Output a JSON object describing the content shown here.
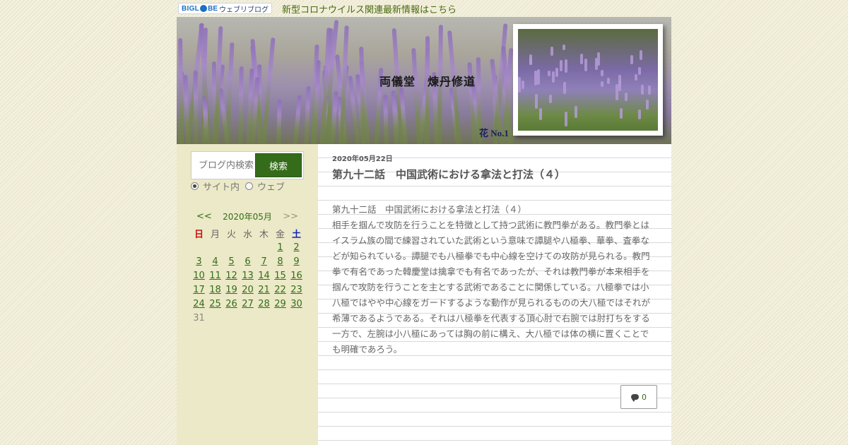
{
  "topbar": {
    "logo": {
      "part1": "BIGL",
      "part2": "BE",
      "part3": "ウェブリブログ"
    },
    "notice_link": "新型コロナウイルス関連最新情報はこちら"
  },
  "header": {
    "blog_title": "両儀堂　煉丹修道",
    "photo_caption": "花 No.1"
  },
  "sidebar": {
    "search": {
      "placeholder": "ブログ内検索",
      "button": "検索"
    },
    "scope": {
      "site": "サイト内",
      "web": "ウェブ",
      "selected": "サイト内"
    },
    "calendar": {
      "prev": "<<",
      "month": "2020年05月",
      "next": ">>",
      "weekdays": [
        "日",
        "月",
        "火",
        "水",
        "木",
        "金",
        "土"
      ],
      "weeks": [
        [
          "",
          "",
          "",
          "",
          "",
          "1",
          "2"
        ],
        [
          "3",
          "4",
          "5",
          "6",
          "7",
          "8",
          "9"
        ],
        [
          "10",
          "11",
          "12",
          "13",
          "14",
          "15",
          "16"
        ],
        [
          "17",
          "18",
          "19",
          "20",
          "21",
          "22",
          "23"
        ],
        [
          "24",
          "25",
          "26",
          "27",
          "28",
          "29",
          "30"
        ],
        [
          "31",
          "",
          "",
          "",
          "",
          "",
          ""
        ]
      ],
      "unlinked_days": [
        "31"
      ]
    }
  },
  "post": {
    "date": "2020年05月22日",
    "title": "第九十二話　中国武術における拿法と打法（４）",
    "body": [
      "第九十二話　中国武術における拿法と打法（４）",
      "相手を掴んで攻防を行うことを特徴として持つ武術に教門拳がある。教門拳とはイスラム族の間で練習されていた武術という意味で譚腿や八極拳、華拳、査拳などが知られている。譚腿でも八極拳でも中心線を空けての攻防が見られる。教門拳で有名であった韓慶堂は擒拿でも有名であったが、それは教門拳が本来相手を掴んで攻防を行うことを主とする武術であることに関係している。八極拳では小八極ではやや中心線をガードするような動作が見られるものの大八極ではそれが希薄であるようである。それは八極拳を代表する頂心肘で右腕では肘打ちをする一方で、左腕は小八極にあっては胸の前に構え、大八極では体の横に置くことでも明確であろう。"
    ],
    "comment_count": "0"
  },
  "colors": {
    "accent_green": "#356c1a",
    "sidebar_bg": "#ebe9c7",
    "sunday": "#cc1111",
    "saturday": "#1122bb"
  }
}
